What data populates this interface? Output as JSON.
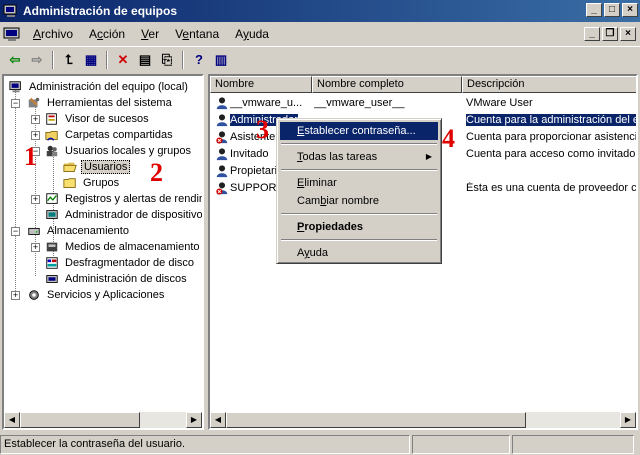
{
  "window": {
    "title": "Administración de equipos",
    "controls": {
      "minimize": "_",
      "maximize": "□",
      "close": "×"
    }
  },
  "menubar": {
    "items": [
      {
        "label": "Archivo",
        "key": "A"
      },
      {
        "label": "Acción",
        "key": "c"
      },
      {
        "label": "Ver",
        "key": "V"
      },
      {
        "label": "Ventana",
        "key": "e"
      },
      {
        "label": "Ayuda",
        "key": "y"
      }
    ],
    "mdi_controls": {
      "minimize": "_",
      "restore": "❐",
      "close": "×"
    }
  },
  "toolbar": {
    "buttons": [
      {
        "name": "back-button",
        "icon": "arrow-left-icon",
        "glyph": "⇦",
        "color": "#008000"
      },
      {
        "name": "forward-button",
        "icon": "arrow-right-icon",
        "glyph": "⇨",
        "color": "#808080"
      },
      {
        "name": "up-level-button",
        "icon": "folder-up-icon",
        "glyph": "⮤",
        "color": "#000000"
      },
      {
        "name": "show-hide-tree-button",
        "icon": "console-tree-icon",
        "glyph": "▦",
        "color": "#000080"
      },
      {
        "name": "delete-button",
        "icon": "delete-x-icon",
        "glyph": "✕",
        "color": "#d00000"
      },
      {
        "name": "properties-button",
        "icon": "properties-icon",
        "glyph": "▤",
        "color": "#000000"
      },
      {
        "name": "export-list-button",
        "icon": "export-list-icon",
        "glyph": "⎘",
        "color": "#000000"
      },
      {
        "name": "help-button",
        "icon": "help-icon",
        "glyph": "?",
        "color": "#000080"
      },
      {
        "name": "show-hide-action-pane-button",
        "icon": "action-pane-icon",
        "glyph": "▥",
        "color": "#000080"
      }
    ]
  },
  "tree": {
    "items": [
      {
        "id": "root",
        "label": "Administración del equipo (local)",
        "icon": "computer-management-icon"
      },
      {
        "id": "system-tools",
        "label": "Herramientas del sistema",
        "icon": "tools-icon"
      },
      {
        "id": "event-viewer",
        "label": "Visor de sucesos",
        "icon": "event-viewer-icon"
      },
      {
        "id": "shared-folders",
        "label": "Carpetas compartidas",
        "icon": "shared-folder-icon"
      },
      {
        "id": "local-users",
        "label": "Usuarios locales y grupos",
        "icon": "users-groups-icon"
      },
      {
        "id": "users",
        "label": "Usuarios",
        "icon": "folder-open-icon"
      },
      {
        "id": "groups",
        "label": "Grupos",
        "icon": "folder-icon"
      },
      {
        "id": "perf-logs",
        "label": "Registros y alertas de rendir",
        "icon": "performance-logs-icon"
      },
      {
        "id": "device-manager",
        "label": "Administrador de dispositivo",
        "icon": "device-manager-icon"
      },
      {
        "id": "storage",
        "label": "Almacenamiento",
        "icon": "storage-icon"
      },
      {
        "id": "removable-storage",
        "label": "Medios de almacenamiento e",
        "icon": "removable-storage-icon"
      },
      {
        "id": "defrag",
        "label": "Desfragmentador de disco",
        "icon": "defrag-icon"
      },
      {
        "id": "disk-management",
        "label": "Administración de discos",
        "icon": "disk-management-icon"
      },
      {
        "id": "services-apps",
        "label": "Servicios y Aplicaciones",
        "icon": "services-icon"
      }
    ]
  },
  "list": {
    "columns": [
      "Nombre",
      "Nombre completo",
      "Descripción"
    ],
    "rows": [
      {
        "name": "__vmware_u...",
        "full_name": "__vmware_user__",
        "description": "VMware User",
        "icon": "user-icon",
        "disabled": false
      },
      {
        "name": "Administrador",
        "full_name": "",
        "description": "Cuenta para la administración del e",
        "icon": "user-icon",
        "disabled": false
      },
      {
        "name": "Asistente",
        "full_name": "",
        "description": "Cuenta para proporcionar asistenci",
        "icon": "user-disabled-icon",
        "disabled": true
      },
      {
        "name": "Invitado",
        "full_name": "",
        "description": "Cuenta para acceso como invitado",
        "icon": "user-icon",
        "disabled": false
      },
      {
        "name": "Propietari",
        "full_name": "",
        "description": "",
        "icon": "user-icon",
        "disabled": false
      },
      {
        "name": "SUPPORT",
        "full_name": "",
        "description": "Ésta es una cuenta de proveedor c",
        "icon": "user-disabled-icon",
        "disabled": true
      }
    ]
  },
  "context_menu": {
    "items": [
      {
        "label": "Establecer contraseña...",
        "key": "E",
        "highlighted": true
      },
      {
        "sep": true
      },
      {
        "label": "Todas las tareas",
        "key": "T",
        "submenu": true
      },
      {
        "sep": true
      },
      {
        "label": "Eliminar",
        "key": "E"
      },
      {
        "label": "Cambiar nombre",
        "key": "b"
      },
      {
        "sep": true
      },
      {
        "label": "Propiedades",
        "key": "P",
        "bold": true
      },
      {
        "sep": true
      },
      {
        "label": "Ayuda",
        "key": "y"
      }
    ]
  },
  "annotations": [
    "1",
    "2",
    "3",
    "4"
  ],
  "status_bar": {
    "text": "Establecer la contraseña del usuario."
  },
  "colors": {
    "selection": "#0a246a",
    "annotation": "#e00000",
    "chrome": "#d4d0c8"
  }
}
